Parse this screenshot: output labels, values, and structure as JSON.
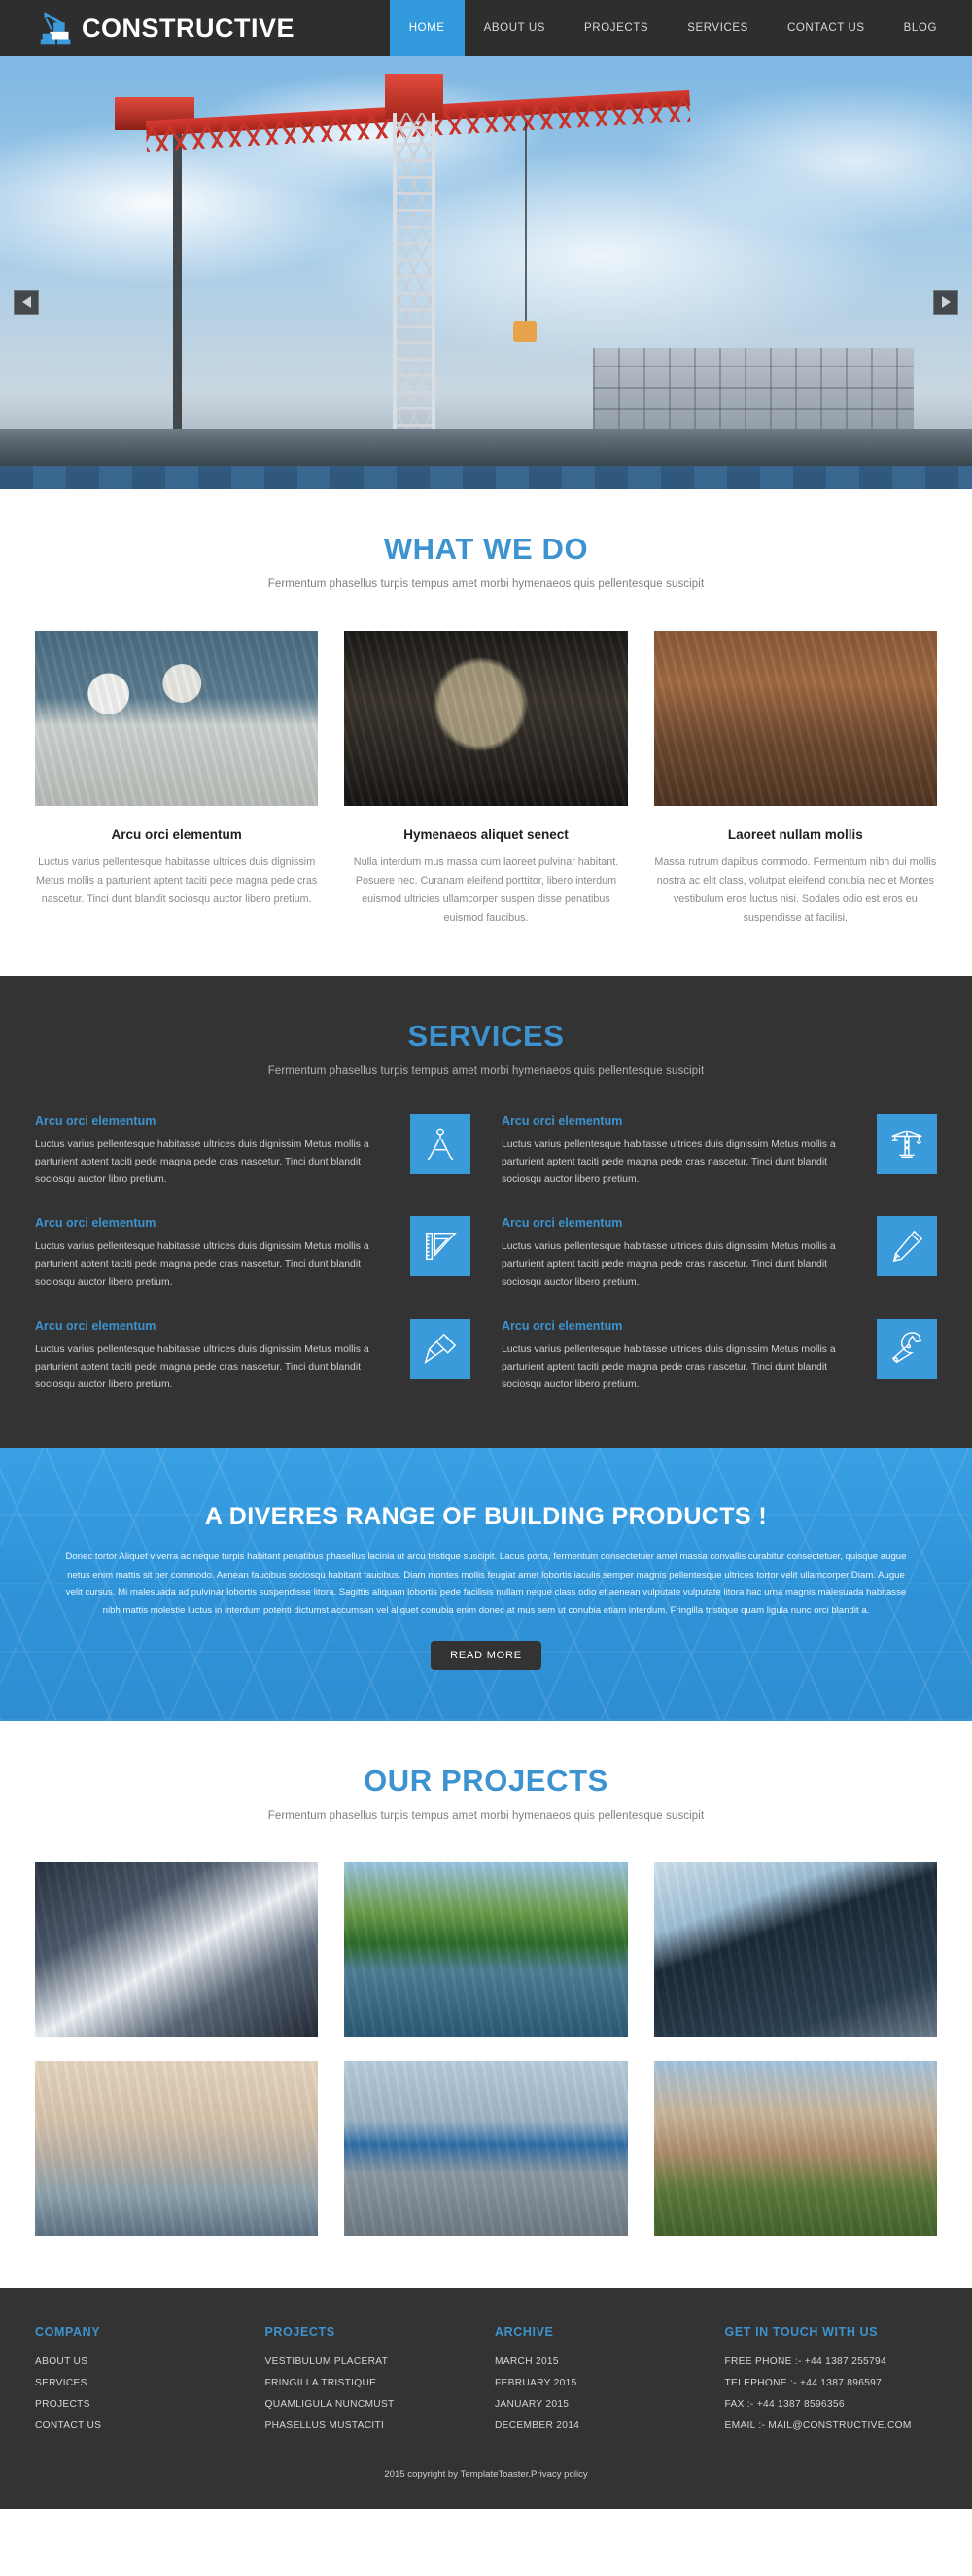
{
  "header": {
    "brand": "CONSTRUCTIVE",
    "nav": [
      {
        "label": "HOME",
        "active": true
      },
      {
        "label": "ABOUT US",
        "active": false
      },
      {
        "label": "PROJECTS",
        "active": false
      },
      {
        "label": "SERVICES",
        "active": false
      },
      {
        "label": "CONTACT US",
        "active": false
      },
      {
        "label": "BLOG",
        "active": false
      }
    ]
  },
  "hero": {
    "prev_label": "◀",
    "next_label": "▶"
  },
  "whatwedo": {
    "title": "WHAT WE DO",
    "subtitle": "Fermentum phasellus turpis tempus amet morbi hymenaeos quis pellentesque suscipit",
    "cards": [
      {
        "title": "Arcu orci elementum",
        "text": "Luctus varius pellentesque habitasse ultrices duis dignissim Metus mollis a parturient aptent taciti pede magna pede cras nascetur. Tinci dunt blandit sociosqu auctor libero pretium."
      },
      {
        "title": "Hymenaeos aliquet senect",
        "text": "Nulla interdum mus massa cum laoreet pulvinar habitant. Posuere nec. Curanam eleifend porttitor, libero interdum euismod ultricies ullamcorper suspen disse penatibus euismod faucibus."
      },
      {
        "title": "Laoreet nullam mollis",
        "text": "Massa rutrum dapibus commodo. Fermentum nibh dui mollis nostra ac elit class, volutpat eleifend conubia nec et Montes vestibulum eros luctus nisi. Sodales odio est eros eu suspendisse at facilisi."
      }
    ]
  },
  "services": {
    "title": "SERVICES",
    "subtitle": "Fermentum phasellus turpis tempus amet morbi hymenaeos quis pellentesque suscipit",
    "items": [
      {
        "title": "Arcu orci elementum",
        "text": "Luctus varius pellentesque habitasse ultrices duis dignissim Metus mollis a parturient aptent taciti pede magna pede cras nascetur. Tinci dunt blandit sociosqu auctor libro pretium.",
        "icon": "compass-divider-icon"
      },
      {
        "title": "Arcu orci elementum",
        "text": "Luctus varius pellentesque habitasse ultrices duis dignissim Metus mollis a parturient aptent taciti pede magna pede cras nascetur. Tinci dunt blandit sociosqu auctor libero pretium.",
        "icon": "crane-icon"
      },
      {
        "title": "Arcu orci elementum",
        "text": "Luctus varius pellentesque habitasse ultrices duis dignissim Metus mollis a parturient aptent taciti pede magna pede cras nascetur. Tinci dunt blandit sociosqu auctor libero pretium.",
        "icon": "set-square-ruler-icon"
      },
      {
        "title": "Arcu orci elementum",
        "text": "Luctus varius pellentesque habitasse ultrices duis dignissim Metus mollis a parturient aptent taciti pede magna pede cras nascetur. Tinci dunt blandit sociosqu auctor libero pretium.",
        "icon": "pencil-icon"
      },
      {
        "title": "Arcu orci elementum",
        "text": "Luctus varius pellentesque habitasse ultrices duis dignissim Metus mollis a parturient aptent taciti pede magna pede cras nascetur. Tinci dunt blandit sociosqu auctor libero pretium.",
        "icon": "screwdriver-icon"
      },
      {
        "title": "Arcu orci elementum",
        "text": "Luctus varius pellentesque habitasse ultrices duis dignissim Metus mollis a parturient aptent taciti pede magna pede cras nascetur. Tinci dunt blandit sociosqu auctor libero pretium.",
        "icon": "wrench-icon"
      }
    ]
  },
  "cta": {
    "title": "A DIVERES RANGE OF BUILDING PRODUCTS !",
    "text": "Donec tortor Aliquet viverra ac neque turpis habitant penatibus phasellus lacinia ut arcu tristique suscipit. Lacus porta, fermentum consectetuer amet massa convallis curabitur consectetuer, quisque augue netus enim mattis sit per commodo. Aenean faucibus sociosqu habitant faucibus. Diam montes mollis feugiat amet lobortis iaculis semper magnis pellentesque ultrices tortor velit ullamcorper Diam. Augue velit cursus. Mi malesuada ad pulvinar lobortis suspendisse litora. Sagittis aliquam lobortis pede facilisis nullam neque class odio et aenean vulputate vulputate litora hac urna magnis malesuada habitasse nibh mattis molestie luctus in interdum potenti dictumst accumsan vel aliquet conubia enim donec at mus sem ut conubia etiam interdum. Fringilla tristique quam ligula nunc orci blandit a.",
    "button": "READ MORE"
  },
  "projects": {
    "title": "OUR PROJECTS",
    "subtitle": "Fermentum phasellus turpis tempus amet morbi hymenaeos quis pellentesque suscipit",
    "items": [
      {
        "name": "glass-atrium-ceiling"
      },
      {
        "name": "green-arch-bridge"
      },
      {
        "name": "glass-office-tower"
      },
      {
        "name": "suspension-bridge-fog"
      },
      {
        "name": "industrial-warehouse"
      },
      {
        "name": "brick-mansion-house"
      }
    ]
  },
  "footer": {
    "columns": [
      {
        "heading": "COMPANY",
        "links": [
          "ABOUT US",
          "SERVICES",
          "PROJECTS",
          "CONTACT US"
        ]
      },
      {
        "heading": "PROJECTS",
        "links": [
          "VESTIBULUM PLACERAT",
          "FRINGILLA TRISTIQUE",
          "QUAMLIGULA NUNCMUST",
          "PHASELLUS MUSTACITI"
        ]
      },
      {
        "heading": "ARCHIVE",
        "links": [
          "MARCH 2015",
          "FEBRUARY 2015",
          "JANUARY 2015",
          "DECEMBER 2014"
        ]
      },
      {
        "heading": "GET IN TOUCH WITH US",
        "links": [
          "FREE PHONE :- +44 1387 255794",
          "TELEPHONE :- +44 1387 896597",
          "FAX :- +44 1387 8596356",
          "EMAIL :- MAIL@CONSTRUCTIVE.COM"
        ]
      }
    ],
    "copyright": "2015 copyright by TemplateToaster.Privacy policy"
  },
  "colors": {
    "accent": "#3d93cf",
    "nav_active": "#3399dd",
    "dark": "#333333",
    "cta_blue": "#2f93d8"
  }
}
